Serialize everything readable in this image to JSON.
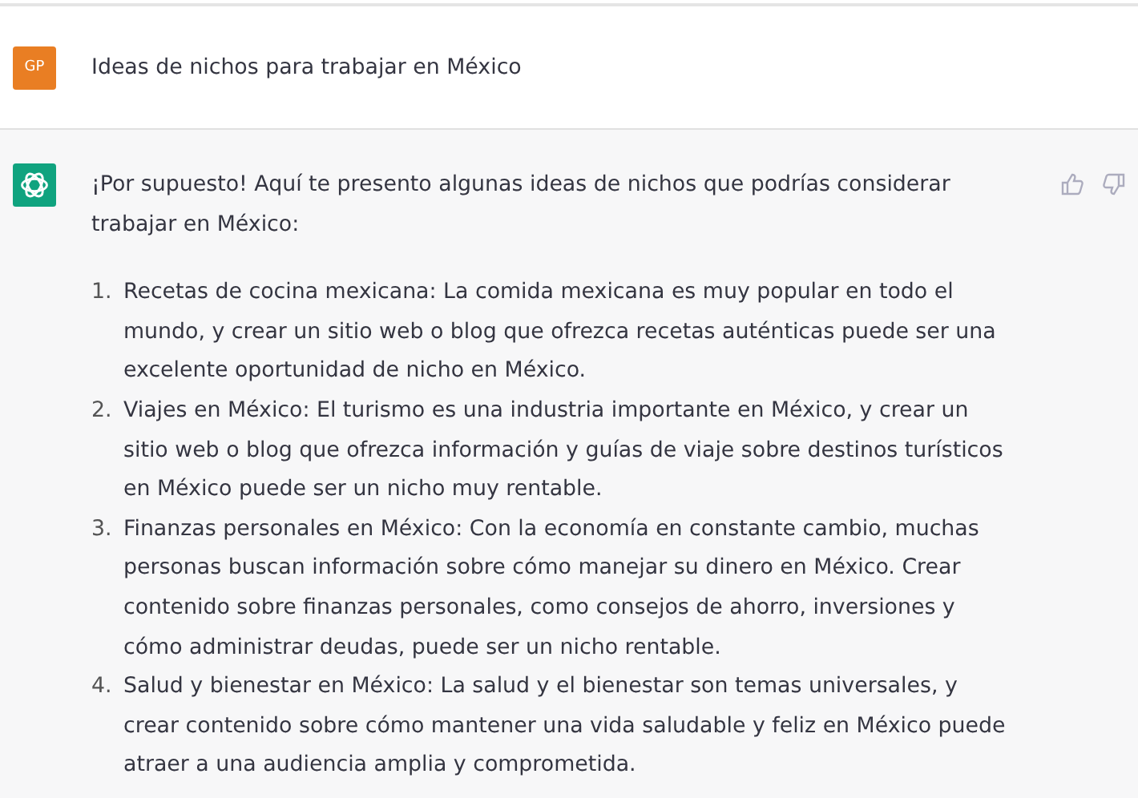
{
  "user_message": {
    "avatar": "GP",
    "text": "Ideas de nichos para trabajar en México"
  },
  "assistant_message": {
    "intro": "¡Por supuesto! Aquí te presento algunas ideas de nichos que podrías considerar trabajar en México:",
    "items": [
      {
        "number": "1.",
        "text": "Recetas de cocina mexicana: La comida mexicana es muy popular en todo el mundo, y crear un sitio web o blog que ofrezca recetas auténticas puede ser una excelente oportunidad de nicho en México."
      },
      {
        "number": "2.",
        "text": "Viajes en México: El turismo es una industria importante en México, y crear un sitio web o blog que ofrezca información y guías de viaje sobre destinos turísticos en México puede ser un nicho muy rentable."
      },
      {
        "number": "3.",
        "text": "Finanzas personales en México: Con la economía en constante cambio, muchas personas buscan información sobre cómo manejar su dinero en México. Crear contenido sobre finanzas personales, como consejos de ahorro, inversiones y cómo administrar deudas, puede ser un nicho rentable."
      },
      {
        "number": "4.",
        "text": "Salud y bienestar en México: La salud y el bienestar son temas universales, y crear contenido sobre cómo mantener una vida saludable y feliz en México puede atraer a una audiencia amplia y comprometida."
      }
    ]
  }
}
